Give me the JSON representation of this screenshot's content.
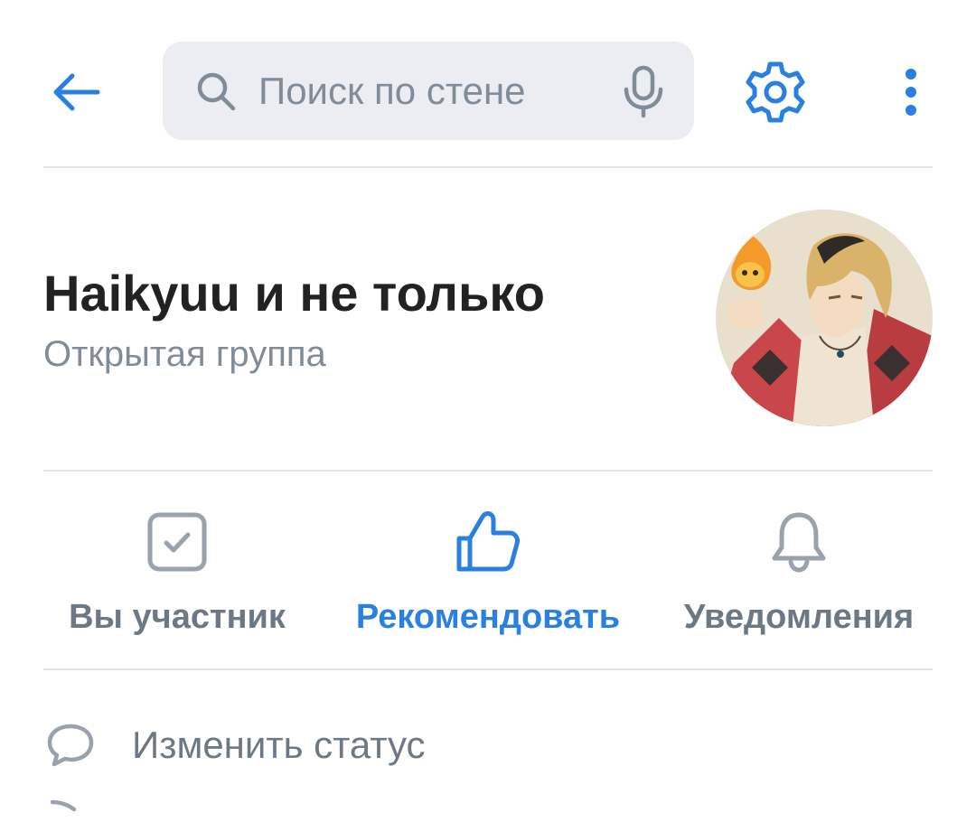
{
  "search": {
    "placeholder": "Поиск по стене"
  },
  "group": {
    "name": "Haikyuu и не только",
    "type": "Открытая группа"
  },
  "actions": [
    {
      "label": "Вы участник",
      "icon": "checkbox-checked-icon",
      "color": "#6d7885"
    },
    {
      "label": "Рекомендовать",
      "icon": "thumbs-up-icon",
      "color": "#2a80e0"
    },
    {
      "label": "Уведомления",
      "icon": "bell-icon",
      "color": "#6d7885"
    }
  ],
  "status_row": {
    "label": "Изменить статус",
    "icon": "speech-bubble-icon"
  },
  "colors": {
    "accent": "#2a80e0",
    "secondary_text": "#818c99",
    "icon_gray": "#99a2ad",
    "search_bg": "#ebedf2"
  }
}
